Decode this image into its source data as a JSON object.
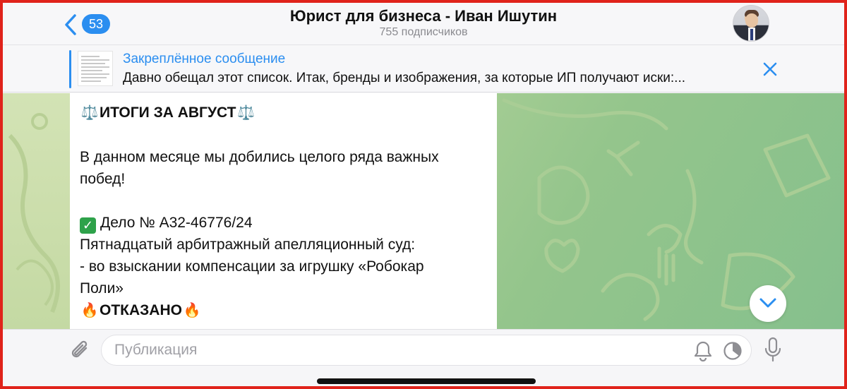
{
  "header": {
    "back_count": "53",
    "title": "Юрист для бизнеса - Иван Ишутин",
    "subtitle": "755 подписчиков"
  },
  "pinned": {
    "label": "Закреплённое сообщение",
    "text": "Давно обещал этот список. Итак, бренды и изображения, за которые ИП получают иски:..."
  },
  "message": {
    "heading": "ИТОГИ ЗА АВГУСТ",
    "intro_line1": "В данном месяце мы добились целого ряда важных",
    "intro_line2": "побед!",
    "case": "Дело № А32-46776/24",
    "court": "Пятнадцатый арбитражный апелляционный суд:",
    "claim_line1": "- во взыскании компенсации за игрушку «Робокар",
    "claim_line2": "Поли»",
    "result": "ОТКАЗАНО",
    "icons": [
      "scales-icon",
      "check-icon",
      "fire-icon"
    ]
  },
  "composer": {
    "placeholder": "Публикация"
  },
  "colors": {
    "accent": "#2b8ef0",
    "frame_border": "#e0231b",
    "check": "#2ea24a"
  }
}
